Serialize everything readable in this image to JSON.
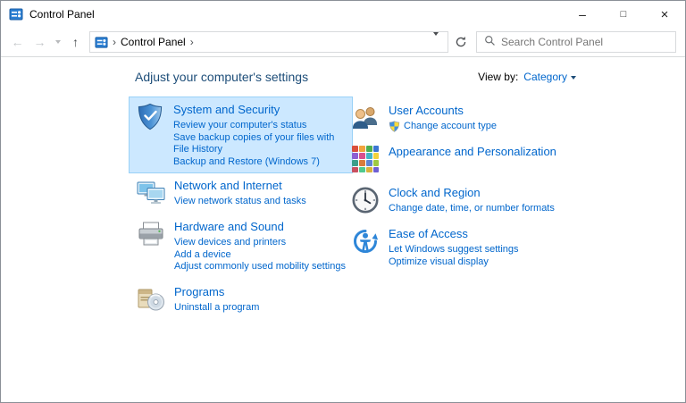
{
  "colors": {
    "link_blue": "#0066cc",
    "heading_blue": "#1e4e79",
    "selection_fill": "#cce8ff",
    "selection_border": "#99d1f7",
    "titlebar_bg": "#ffffff",
    "content_bg": "#ffffff"
  },
  "titlebar": {
    "title": "Control Panel",
    "minimize_glyph": "–",
    "maximize_glyph": "□",
    "close_glyph": "×"
  },
  "navbar": {
    "back_glyph": "←",
    "forward_glyph": "→",
    "up_glyph": "↑",
    "breadcrumb": {
      "separator": "›",
      "root": "Control Panel"
    },
    "search": {
      "placeholder": "Search Control Panel"
    }
  },
  "content": {
    "heading": "Adjust your computer's settings",
    "view_by": {
      "label": "View by:",
      "value": "Category"
    }
  },
  "categories": [
    {
      "title": "System and Security",
      "highlighted": true,
      "links": [
        "Review your computer's status",
        "Save backup copies of your files with File History",
        "Backup and Restore (Windows 7)"
      ]
    },
    {
      "title": "Network and Internet",
      "links": [
        "View network status and tasks"
      ]
    },
    {
      "title": "Hardware and Sound",
      "links": [
        "View devices and printers",
        "Add a device",
        "Adjust commonly used mobility settings"
      ]
    },
    {
      "title": "Programs",
      "links": [
        "Uninstall a program"
      ]
    },
    {
      "title": "User Accounts",
      "link_icon": "uac-shield-icon",
      "links": [
        "Change account type"
      ]
    },
    {
      "title": "Appearance and Personalization",
      "links": []
    },
    {
      "title": "Clock and Region",
      "links": [
        "Change date, time, or number formats"
      ]
    },
    {
      "title": "Ease of Access",
      "links": [
        "Let Windows suggest settings",
        "Optimize visual display"
      ]
    }
  ]
}
